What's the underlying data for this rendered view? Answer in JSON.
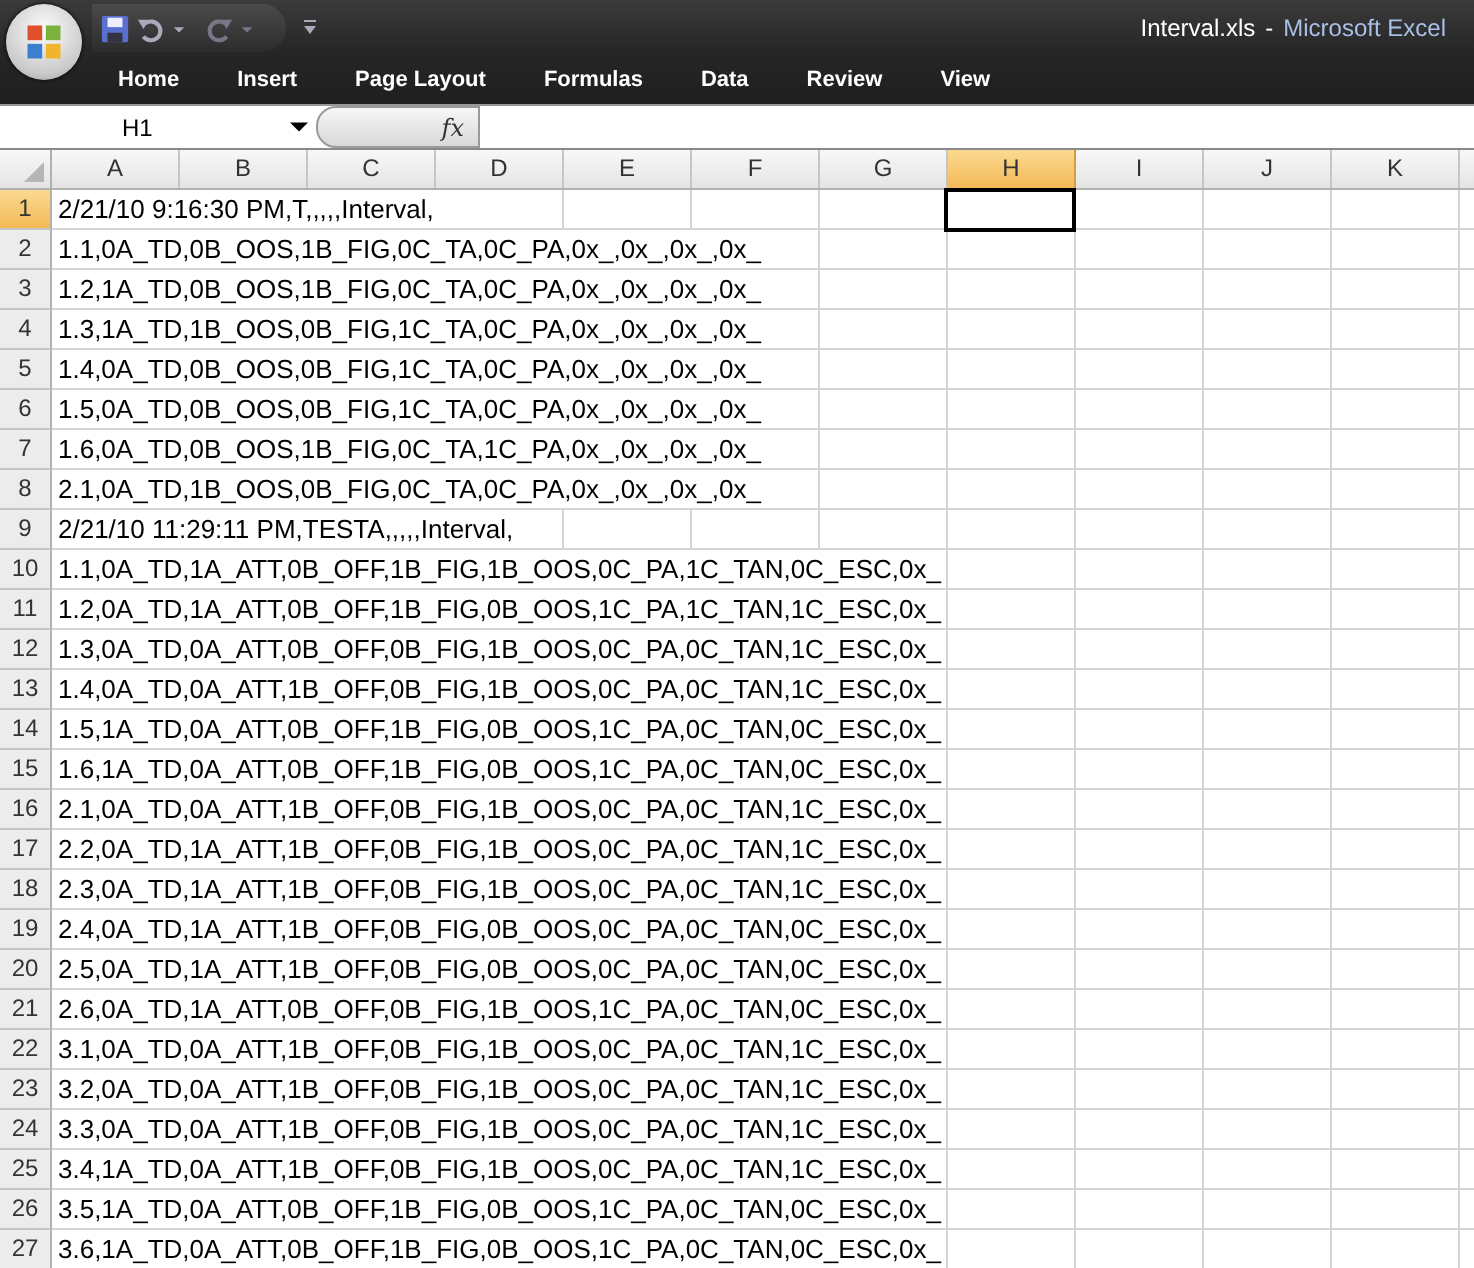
{
  "window": {
    "document_name": "Interval.xls",
    "separator": "-",
    "app_name": "Microsoft Excel"
  },
  "ribbon_tabs": [
    {
      "label": "Home",
      "selected": false
    },
    {
      "label": "Insert",
      "selected": false
    },
    {
      "label": "Page Layout",
      "selected": false
    },
    {
      "label": "Formulas",
      "selected": false
    },
    {
      "label": "Data",
      "selected": false
    },
    {
      "label": "Review",
      "selected": false
    },
    {
      "label": "View",
      "selected": false
    }
  ],
  "formula_bar": {
    "name_box": "H1",
    "function_button": "fx"
  },
  "sheet": {
    "columns": [
      {
        "label": "A",
        "selected": false
      },
      {
        "label": "B",
        "selected": false
      },
      {
        "label": "C",
        "selected": false
      },
      {
        "label": "D",
        "selected": false
      },
      {
        "label": "E",
        "selected": false
      },
      {
        "label": "F",
        "selected": false
      },
      {
        "label": "G",
        "selected": false
      },
      {
        "label": "H",
        "selected": true
      },
      {
        "label": "I",
        "selected": false
      },
      {
        "label": "J",
        "selected": false
      },
      {
        "label": "K",
        "selected": false
      }
    ],
    "rows": [
      {
        "number": "1",
        "selected": true,
        "text": "2/21/10 9:16:30 PM,T,,,,,Interval,"
      },
      {
        "number": "2",
        "selected": false,
        "text": "1.1,0A_TD,0B_OOS,1B_FIG,0C_TA,0C_PA,0x_,0x_,0x_,0x_"
      },
      {
        "number": "3",
        "selected": false,
        "text": "1.2,1A_TD,0B_OOS,1B_FIG,0C_TA,0C_PA,0x_,0x_,0x_,0x_"
      },
      {
        "number": "4",
        "selected": false,
        "text": "1.3,1A_TD,1B_OOS,0B_FIG,1C_TA,0C_PA,0x_,0x_,0x_,0x_"
      },
      {
        "number": "5",
        "selected": false,
        "text": "1.4,0A_TD,0B_OOS,0B_FIG,1C_TA,0C_PA,0x_,0x_,0x_,0x_"
      },
      {
        "number": "6",
        "selected": false,
        "text": "1.5,0A_TD,0B_OOS,0B_FIG,1C_TA,0C_PA,0x_,0x_,0x_,0x_"
      },
      {
        "number": "7",
        "selected": false,
        "text": "1.6,0A_TD,0B_OOS,1B_FIG,0C_TA,1C_PA,0x_,0x_,0x_,0x_"
      },
      {
        "number": "8",
        "selected": false,
        "text": "2.1,0A_TD,1B_OOS,0B_FIG,0C_TA,0C_PA,0x_,0x_,0x_,0x_"
      },
      {
        "number": "9",
        "selected": false,
        "text": "2/21/10 11:29:11 PM,TESTA,,,,,Interval,"
      },
      {
        "number": "10",
        "selected": false,
        "text": "1.1,0A_TD,1A_ATT,0B_OFF,1B_FIG,1B_OOS,0C_PA,1C_TAN,0C_ESC,0x_"
      },
      {
        "number": "11",
        "selected": false,
        "text": "1.2,0A_TD,1A_ATT,0B_OFF,1B_FIG,0B_OOS,1C_PA,1C_TAN,1C_ESC,0x_"
      },
      {
        "number": "12",
        "selected": false,
        "text": "1.3,0A_TD,0A_ATT,0B_OFF,0B_FIG,1B_OOS,0C_PA,0C_TAN,1C_ESC,0x_"
      },
      {
        "number": "13",
        "selected": false,
        "text": "1.4,0A_TD,0A_ATT,1B_OFF,0B_FIG,1B_OOS,0C_PA,0C_TAN,1C_ESC,0x_"
      },
      {
        "number": "14",
        "selected": false,
        "text": "1.5,1A_TD,0A_ATT,0B_OFF,1B_FIG,0B_OOS,1C_PA,0C_TAN,0C_ESC,0x_"
      },
      {
        "number": "15",
        "selected": false,
        "text": "1.6,1A_TD,0A_ATT,0B_OFF,1B_FIG,0B_OOS,1C_PA,0C_TAN,0C_ESC,0x_"
      },
      {
        "number": "16",
        "selected": false,
        "text": "2.1,0A_TD,0A_ATT,1B_OFF,0B_FIG,1B_OOS,0C_PA,0C_TAN,1C_ESC,0x_"
      },
      {
        "number": "17",
        "selected": false,
        "text": "2.2,0A_TD,1A_ATT,1B_OFF,0B_FIG,1B_OOS,0C_PA,0C_TAN,1C_ESC,0x_"
      },
      {
        "number": "18",
        "selected": false,
        "text": "2.3,0A_TD,1A_ATT,1B_OFF,0B_FIG,1B_OOS,0C_PA,0C_TAN,1C_ESC,0x_"
      },
      {
        "number": "19",
        "selected": false,
        "text": "2.4,0A_TD,1A_ATT,1B_OFF,0B_FIG,0B_OOS,0C_PA,0C_TAN,0C_ESC,0x_"
      },
      {
        "number": "20",
        "selected": false,
        "text": "2.5,0A_TD,1A_ATT,1B_OFF,0B_FIG,0B_OOS,0C_PA,0C_TAN,0C_ESC,0x_"
      },
      {
        "number": "21",
        "selected": false,
        "text": "2.6,0A_TD,1A_ATT,0B_OFF,0B_FIG,1B_OOS,1C_PA,0C_TAN,0C_ESC,0x_"
      },
      {
        "number": "22",
        "selected": false,
        "text": "3.1,0A_TD,0A_ATT,1B_OFF,0B_FIG,1B_OOS,0C_PA,0C_TAN,1C_ESC,0x_"
      },
      {
        "number": "23",
        "selected": false,
        "text": "3.2,0A_TD,0A_ATT,1B_OFF,0B_FIG,1B_OOS,0C_PA,0C_TAN,1C_ESC,0x_"
      },
      {
        "number": "24",
        "selected": false,
        "text": "3.3,0A_TD,0A_ATT,1B_OFF,0B_FIG,1B_OOS,0C_PA,0C_TAN,1C_ESC,0x_"
      },
      {
        "number": "25",
        "selected": false,
        "text": "3.4,1A_TD,0A_ATT,1B_OFF,0B_FIG,1B_OOS,0C_PA,0C_TAN,1C_ESC,0x_"
      },
      {
        "number": "26",
        "selected": false,
        "text": "3.5,1A_TD,0A_ATT,0B_OFF,1B_FIG,0B_OOS,1C_PA,0C_TAN,0C_ESC,0x_"
      },
      {
        "number": "27",
        "selected": false,
        "text": "3.6,1A_TD,0A_ATT,0B_OFF,1B_FIG,0B_OOS,1C_PA,0C_TAN,0C_ESC,0x_"
      }
    ]
  }
}
